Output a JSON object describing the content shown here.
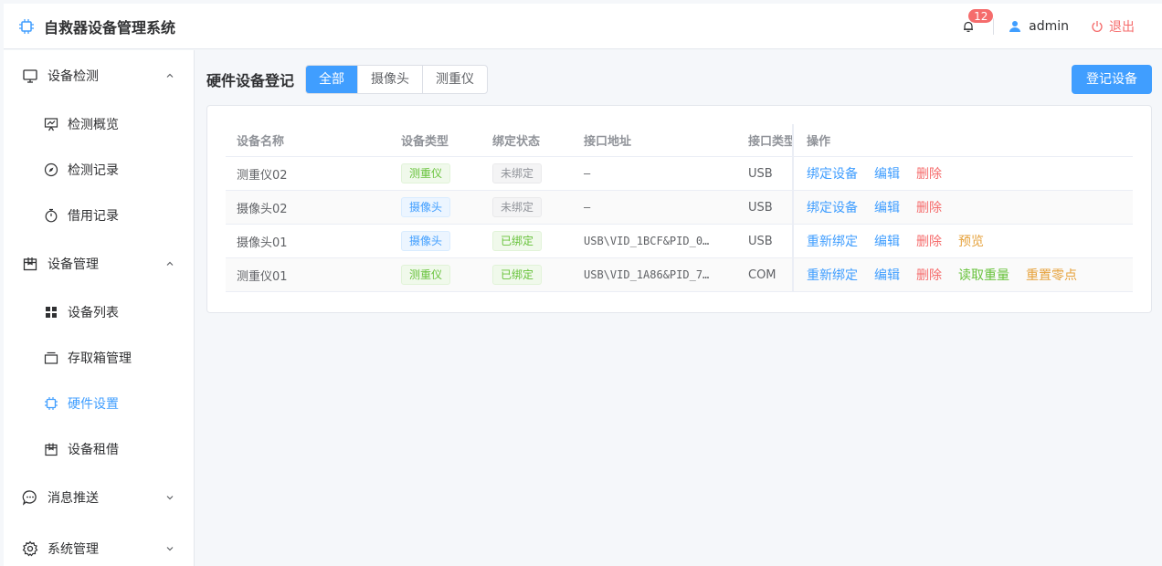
{
  "header": {
    "title": "自救器设备管理系统",
    "notification_count": "12",
    "user": "admin",
    "logout": "退出"
  },
  "sidebar": {
    "groups": [
      {
        "label": "设备检测",
        "icon": "monitor-icon",
        "expanded": true,
        "items": [
          {
            "label": "检测概览",
            "icon": "presentation-chart-icon"
          },
          {
            "label": "检测记录",
            "icon": "compass-icon"
          },
          {
            "label": "借用记录",
            "icon": "stopwatch-icon"
          }
        ]
      },
      {
        "label": "设备管理",
        "icon": "box-icon",
        "expanded": true,
        "items": [
          {
            "label": "设备列表",
            "icon": "grid-icon"
          },
          {
            "label": "存取箱管理",
            "icon": "tray-icon"
          },
          {
            "label": "硬件设置",
            "icon": "chip-icon",
            "active": true
          },
          {
            "label": "设备租借",
            "icon": "box-icon"
          }
        ]
      },
      {
        "label": "消息推送",
        "icon": "chat-icon",
        "expanded": false
      },
      {
        "label": "系统管理",
        "icon": "gear-icon",
        "expanded": false
      }
    ]
  },
  "main": {
    "title": "硬件设备登记",
    "filters": [
      "全部",
      "摄像头",
      "测重仪"
    ],
    "active_filter": "全部",
    "register_button": "登记设备",
    "table": {
      "columns": [
        "设备名称",
        "设备类型",
        "绑定状态",
        "接口地址",
        "接口类型",
        "操作"
      ],
      "rows": [
        {
          "name": "测重仪02",
          "type": "测重仪",
          "type_color": "green",
          "bind": "未绑定",
          "bind_color": "gray",
          "addr": "—",
          "iface": "USB",
          "ops": [
            {
              "label": "绑定设备",
              "kind": "primary"
            },
            {
              "label": "编辑",
              "kind": "primary"
            },
            {
              "label": "删除",
              "kind": "danger"
            }
          ]
        },
        {
          "name": "摄像头02",
          "type": "摄像头",
          "type_color": "blue",
          "bind": "未绑定",
          "bind_color": "gray",
          "addr": "—",
          "iface": "USB",
          "ops": [
            {
              "label": "绑定设备",
              "kind": "primary"
            },
            {
              "label": "编辑",
              "kind": "primary"
            },
            {
              "label": "删除",
              "kind": "danger"
            }
          ]
        },
        {
          "name": "摄像头01",
          "type": "摄像头",
          "type_color": "blue",
          "bind": "已绑定",
          "bind_color": "green",
          "addr": "USB\\VID_1BCF&PID_0…",
          "iface": "USB",
          "ops": [
            {
              "label": "重新绑定",
              "kind": "primary"
            },
            {
              "label": "编辑",
              "kind": "primary"
            },
            {
              "label": "删除",
              "kind": "danger"
            },
            {
              "label": "预览",
              "kind": "warning"
            }
          ]
        },
        {
          "name": "测重仪01",
          "type": "测重仪",
          "type_color": "green",
          "bind": "已绑定",
          "bind_color": "green",
          "addr": "USB\\VID_1A86&PID_7…",
          "iface": "COM",
          "ops": [
            {
              "label": "重新绑定",
              "kind": "primary"
            },
            {
              "label": "编辑",
              "kind": "primary"
            },
            {
              "label": "删除",
              "kind": "danger"
            },
            {
              "label": "读取重量",
              "kind": "success"
            },
            {
              "label": "重置零点",
              "kind": "warning"
            }
          ]
        }
      ]
    }
  },
  "colors": {
    "primary": "#409eff",
    "danger": "#f56c6c",
    "success": "#67c23a",
    "warning": "#e6a23c"
  }
}
